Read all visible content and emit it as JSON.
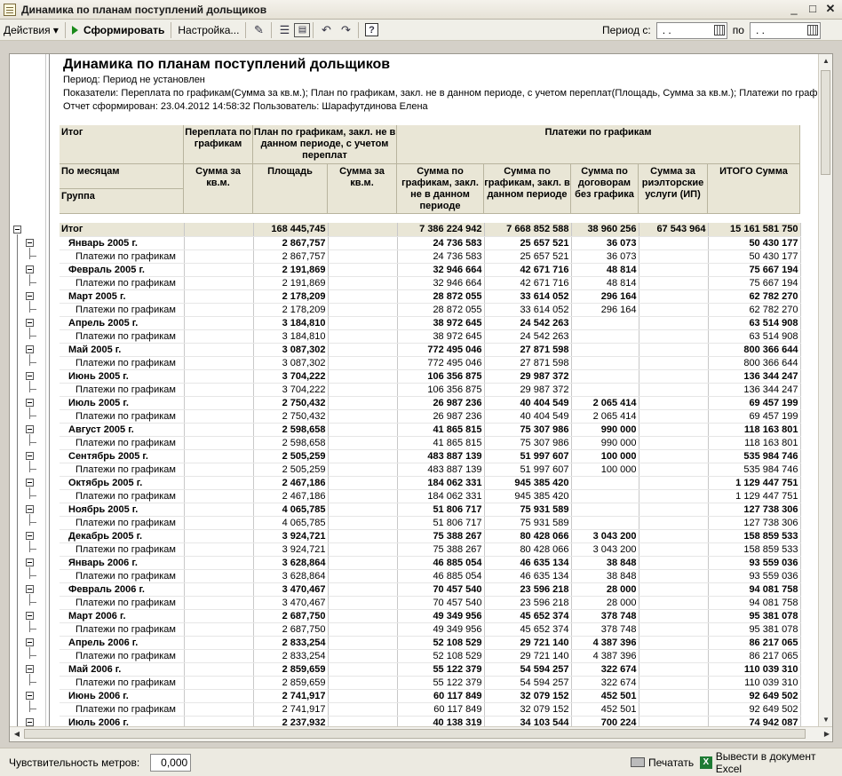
{
  "window": {
    "title": "Динамика по планам поступлений дольщиков",
    "min": "_",
    "max": "□",
    "close": "✕"
  },
  "toolbar": {
    "actions": "Действия ▾",
    "generate": "Сформировать",
    "settings": "Настройка...",
    "period_from_label": "Период с:",
    "period_to_label": "по",
    "date_from": ". .",
    "date_to": ". .",
    "help": "?"
  },
  "report": {
    "title": "Динамика по планам поступлений дольщиков",
    "period": "Период: Период не установлен",
    "indicators": "Показатели: Переплата по графикам(Сумма за кв.м.); План по графикам, закл. не в данном периоде, с учетом переплат(Площадь, Сумма за кв.м.); Платежи по графикам(Су",
    "generated": "Отчет сформирован: 23.04.2012 14:58:32 Пользователь: Шарафутдинова Елена"
  },
  "headers": {
    "itog": "Итог",
    "by_month": "По месяцам",
    "group": "Группа",
    "overpay": "Переплата по графикам",
    "overpay_sum": "Сумма за кв.м.",
    "plan": "План по графикам, закл. не в данном периоде, с учетом переплат",
    "plan_area": "Площадь",
    "plan_sum": "Сумма за кв.м.",
    "payments": "Платежи по графикам",
    "pay_notin": "Сумма по графикам, закл. не в данном периоде",
    "pay_in": "Сумма по графикам, закл. в данном периоде",
    "pay_contract": "Сумма по договорам без графика",
    "pay_realty": "Сумма за риэлторские услуги (ИП)",
    "total": "ИТОГО Сумма"
  },
  "rows": [
    {
      "t": "tot",
      "name": "Итог",
      "area": "168 445,745",
      "c1": "7 386 224 942",
      "c2": "7 668 852 588",
      "c3": "38 960 256",
      "c4": "67 543 964",
      "tot": "15 161 581 750"
    },
    {
      "t": "grp",
      "name": "Январь 2005 г.",
      "area": "2 867,757",
      "c1": "24 736 583",
      "c2": "25 657 521",
      "c3": "36 073",
      "c4": "",
      "tot": "50 430 177"
    },
    {
      "t": "det",
      "name": "Платежи по графикам",
      "area": "2 867,757",
      "c1": "24 736 583",
      "c2": "25 657 521",
      "c3": "36 073",
      "c4": "",
      "tot": "50 430 177"
    },
    {
      "t": "grp",
      "name": "Февраль 2005 г.",
      "area": "2 191,869",
      "c1": "32 946 664",
      "c2": "42 671 716",
      "c3": "48 814",
      "c4": "",
      "tot": "75 667 194"
    },
    {
      "t": "det",
      "name": "Платежи по графикам",
      "area": "2 191,869",
      "c1": "32 946 664",
      "c2": "42 671 716",
      "c3": "48 814",
      "c4": "",
      "tot": "75 667 194"
    },
    {
      "t": "grp",
      "name": "Март 2005 г.",
      "area": "2 178,209",
      "c1": "28 872 055",
      "c2": "33 614 052",
      "c3": "296 164",
      "c4": "",
      "tot": "62 782 270"
    },
    {
      "t": "det",
      "name": "Платежи по графикам",
      "area": "2 178,209",
      "c1": "28 872 055",
      "c2": "33 614 052",
      "c3": "296 164",
      "c4": "",
      "tot": "62 782 270"
    },
    {
      "t": "grp",
      "name": "Апрель 2005 г.",
      "area": "3 184,810",
      "c1": "38 972 645",
      "c2": "24 542 263",
      "c3": "",
      "c4": "",
      "tot": "63 514 908"
    },
    {
      "t": "det",
      "name": "Платежи по графикам",
      "area": "3 184,810",
      "c1": "38 972 645",
      "c2": "24 542 263",
      "c3": "",
      "c4": "",
      "tot": "63 514 908"
    },
    {
      "t": "grp",
      "name": "Май 2005 г.",
      "area": "3 087,302",
      "c1": "772 495 046",
      "c2": "27 871 598",
      "c3": "",
      "c4": "",
      "tot": "800 366 644"
    },
    {
      "t": "det",
      "name": "Платежи по графикам",
      "area": "3 087,302",
      "c1": "772 495 046",
      "c2": "27 871 598",
      "c3": "",
      "c4": "",
      "tot": "800 366 644"
    },
    {
      "t": "grp",
      "name": "Июнь 2005 г.",
      "area": "3 704,222",
      "c1": "106 356 875",
      "c2": "29 987 372",
      "c3": "",
      "c4": "",
      "tot": "136 344 247"
    },
    {
      "t": "det",
      "name": "Платежи по графикам",
      "area": "3 704,222",
      "c1": "106 356 875",
      "c2": "29 987 372",
      "c3": "",
      "c4": "",
      "tot": "136 344 247"
    },
    {
      "t": "grp",
      "name": "Июль 2005 г.",
      "area": "2 750,432",
      "c1": "26 987 236",
      "c2": "40 404 549",
      "c3": "2 065 414",
      "c4": "",
      "tot": "69 457 199"
    },
    {
      "t": "det",
      "name": "Платежи по графикам",
      "area": "2 750,432",
      "c1": "26 987 236",
      "c2": "40 404 549",
      "c3": "2 065 414",
      "c4": "",
      "tot": "69 457 199"
    },
    {
      "t": "grp",
      "name": "Август 2005 г.",
      "area": "2 598,658",
      "c1": "41 865 815",
      "c2": "75 307 986",
      "c3": "990 000",
      "c4": "",
      "tot": "118 163 801"
    },
    {
      "t": "det",
      "name": "Платежи по графикам",
      "area": "2 598,658",
      "c1": "41 865 815",
      "c2": "75 307 986",
      "c3": "990 000",
      "c4": "",
      "tot": "118 163 801"
    },
    {
      "t": "grp",
      "name": "Сентябрь 2005 г.",
      "area": "2 505,259",
      "c1": "483 887 139",
      "c2": "51 997 607",
      "c3": "100 000",
      "c4": "",
      "tot": "535 984 746"
    },
    {
      "t": "det",
      "name": "Платежи по графикам",
      "area": "2 505,259",
      "c1": "483 887 139",
      "c2": "51 997 607",
      "c3": "100 000",
      "c4": "",
      "tot": "535 984 746"
    },
    {
      "t": "grp",
      "name": "Октябрь 2005 г.",
      "area": "2 467,186",
      "c1": "184 062 331",
      "c2": "945 385 420",
      "c3": "",
      "c4": "",
      "tot": "1 129 447 751"
    },
    {
      "t": "det",
      "name": "Платежи по графикам",
      "area": "2 467,186",
      "c1": "184 062 331",
      "c2": "945 385 420",
      "c3": "",
      "c4": "",
      "tot": "1 129 447 751"
    },
    {
      "t": "grp",
      "name": "Ноябрь 2005 г.",
      "area": "4 065,785",
      "c1": "51 806 717",
      "c2": "75 931 589",
      "c3": "",
      "c4": "",
      "tot": "127 738 306"
    },
    {
      "t": "det",
      "name": "Платежи по графикам",
      "area": "4 065,785",
      "c1": "51 806 717",
      "c2": "75 931 589",
      "c3": "",
      "c4": "",
      "tot": "127 738 306"
    },
    {
      "t": "grp",
      "name": "Декабрь 2005 г.",
      "area": "3 924,721",
      "c1": "75 388 267",
      "c2": "80 428 066",
      "c3": "3 043 200",
      "c4": "",
      "tot": "158 859 533"
    },
    {
      "t": "det",
      "name": "Платежи по графикам",
      "area": "3 924,721",
      "c1": "75 388 267",
      "c2": "80 428 066",
      "c3": "3 043 200",
      "c4": "",
      "tot": "158 859 533"
    },
    {
      "t": "grp",
      "name": "Январь 2006 г.",
      "area": "3 628,864",
      "c1": "46 885 054",
      "c2": "46 635 134",
      "c3": "38 848",
      "c4": "",
      "tot": "93 559 036"
    },
    {
      "t": "det",
      "name": "Платежи по графикам",
      "area": "3 628,864",
      "c1": "46 885 054",
      "c2": "46 635 134",
      "c3": "38 848",
      "c4": "",
      "tot": "93 559 036"
    },
    {
      "t": "grp",
      "name": "Февраль 2006 г.",
      "area": "3 470,467",
      "c1": "70 457 540",
      "c2": "23 596 218",
      "c3": "28 000",
      "c4": "",
      "tot": "94 081 758"
    },
    {
      "t": "det",
      "name": "Платежи по графикам",
      "area": "3 470,467",
      "c1": "70 457 540",
      "c2": "23 596 218",
      "c3": "28 000",
      "c4": "",
      "tot": "94 081 758"
    },
    {
      "t": "grp",
      "name": "Март 2006 г.",
      "area": "2 687,750",
      "c1": "49 349 956",
      "c2": "45 652 374",
      "c3": "378 748",
      "c4": "",
      "tot": "95 381 078"
    },
    {
      "t": "det",
      "name": "Платежи по графикам",
      "area": "2 687,750",
      "c1": "49 349 956",
      "c2": "45 652 374",
      "c3": "378 748",
      "c4": "",
      "tot": "95 381 078"
    },
    {
      "t": "grp",
      "name": "Апрель 2006 г.",
      "area": "2 833,254",
      "c1": "52 108 529",
      "c2": "29 721 140",
      "c3": "4 387 396",
      "c4": "",
      "tot": "86 217 065"
    },
    {
      "t": "det",
      "name": "Платежи по графикам",
      "area": "2 833,254",
      "c1": "52 108 529",
      "c2": "29 721 140",
      "c3": "4 387 396",
      "c4": "",
      "tot": "86 217 065"
    },
    {
      "t": "grp",
      "name": "Май 2006 г.",
      "area": "2 859,659",
      "c1": "55 122 379",
      "c2": "54 594 257",
      "c3": "322 674",
      "c4": "",
      "tot": "110 039 310"
    },
    {
      "t": "det",
      "name": "Платежи по графикам",
      "area": "2 859,659",
      "c1": "55 122 379",
      "c2": "54 594 257",
      "c3": "322 674",
      "c4": "",
      "tot": "110 039 310"
    },
    {
      "t": "grp",
      "name": "Июнь 2006 г.",
      "area": "2 741,917",
      "c1": "60 117 849",
      "c2": "32 079 152",
      "c3": "452 501",
      "c4": "",
      "tot": "92 649 502"
    },
    {
      "t": "det",
      "name": "Платежи по графикам",
      "area": "2 741,917",
      "c1": "60 117 849",
      "c2": "32 079 152",
      "c3": "452 501",
      "c4": "",
      "tot": "92 649 502"
    },
    {
      "t": "grp",
      "name": "Июль 2006 г.",
      "area": "2 237,932",
      "c1": "40 138 319",
      "c2": "34 103 544",
      "c3": "700 224",
      "c4": "",
      "tot": "74 942 087"
    }
  ],
  "statusbar": {
    "sensitivity_label": "Чувствительность метров:",
    "sensitivity_value": "0,000",
    "print": "Печатать",
    "excel": "Вывести в документ Excel"
  }
}
